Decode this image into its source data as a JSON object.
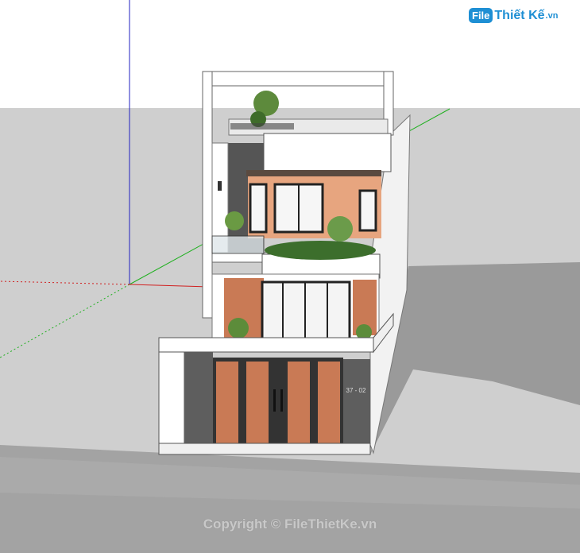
{
  "watermark": {
    "badge": "File",
    "name": "Thiết Kế",
    "domain": ".vn",
    "copyright": "Copyright © FileThietKe.vn"
  },
  "house": {
    "gate_plate": "37 - 02"
  },
  "scene": {
    "sky_color": "#ffffff",
    "ground_color": "#cfcfcf",
    "pavement_color": "#9e9e9e",
    "wall_color": "#ffffff",
    "wood_color": "#c97a55",
    "stone_color": "#5e5e5e",
    "axis_red": "#d02020",
    "axis_green": "#20b020",
    "axis_blue": "#2020c0"
  }
}
